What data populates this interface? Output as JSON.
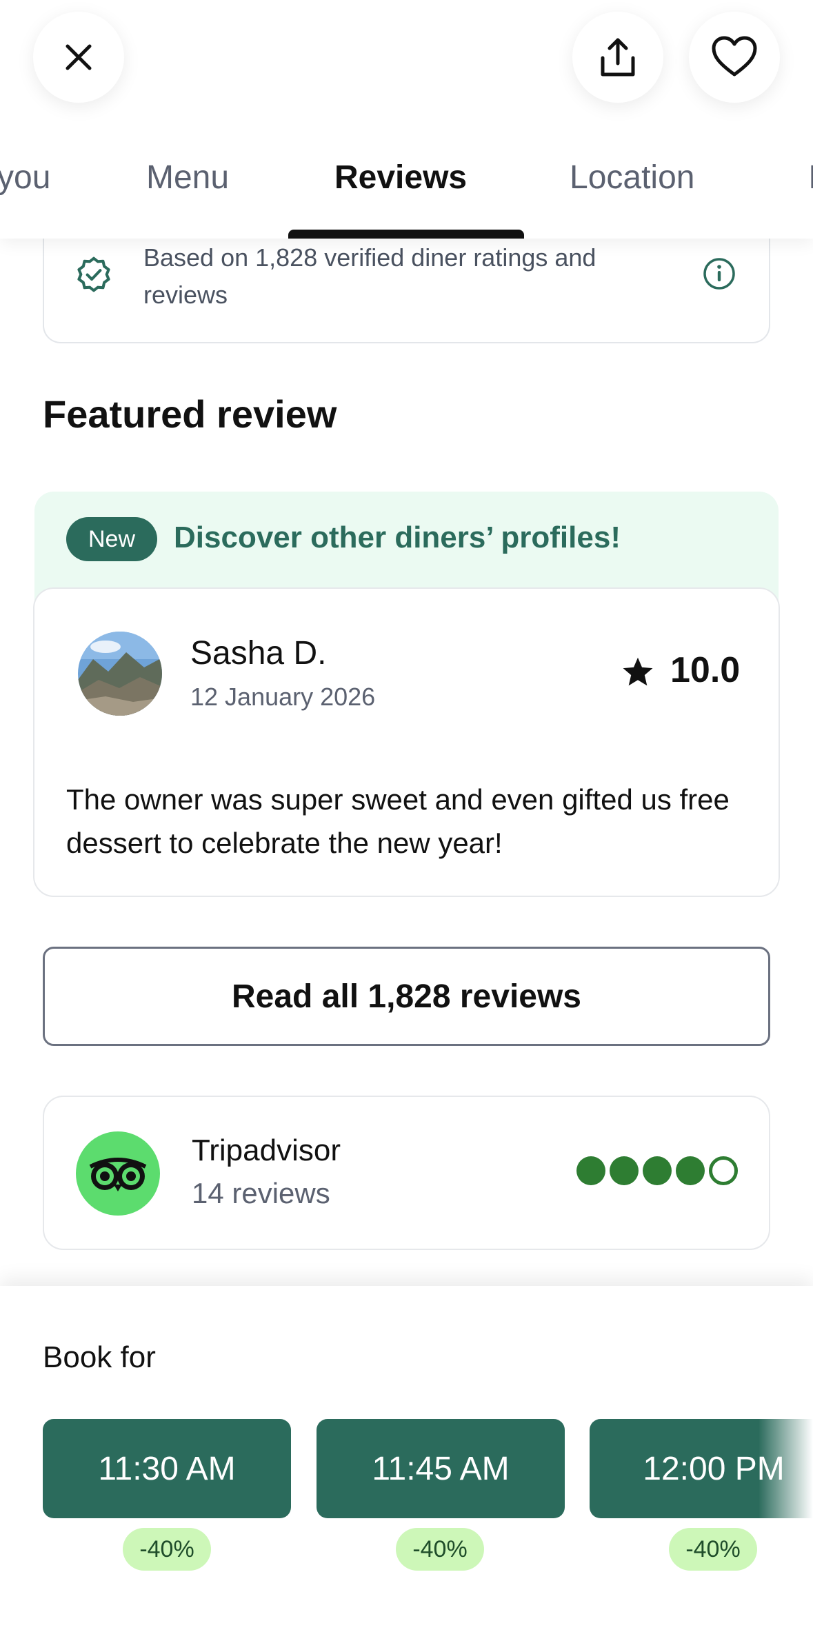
{
  "header": {
    "tabs": [
      {
        "label": "you",
        "active": false
      },
      {
        "label": "Menu",
        "active": false
      },
      {
        "label": "Reviews",
        "active": true
      },
      {
        "label": "Location",
        "active": false
      },
      {
        "label": "I",
        "active": false
      }
    ],
    "icons": {
      "close": "close-icon",
      "share": "share-icon",
      "favorite": "heart-icon"
    }
  },
  "verified": {
    "text": "Based on 1,828 verified diner ratings and reviews"
  },
  "featured": {
    "title": "Featured review",
    "badge": "New",
    "promo": "Discover other diners’ profiles!",
    "review": {
      "name": "Sasha D.",
      "date": "12 January 2026",
      "rating": "10.0",
      "text": "The owner was super sweet and even gifted us free dessert to celebrate the new year!"
    }
  },
  "read_all_label": "Read all 1,828 reviews",
  "tripadvisor": {
    "name": "Tripadvisor",
    "count": "14 reviews",
    "bubbles_filled": 4,
    "bubbles_total": 5,
    "color": "#2e7d32"
  },
  "booking": {
    "label": "Book for",
    "slots": [
      {
        "time": "11:30 AM",
        "discount": "-40%"
      },
      {
        "time": "11:45 AM",
        "discount": "-40%"
      },
      {
        "time": "12:00 PM",
        "discount": "-40%"
      }
    ]
  },
  "colors": {
    "brand": "#2b6b5c",
    "promo_bg": "#ebfaf2",
    "discount_bg": "#cdf7b8",
    "tripadvisor_logo": "#5cdc6e"
  }
}
